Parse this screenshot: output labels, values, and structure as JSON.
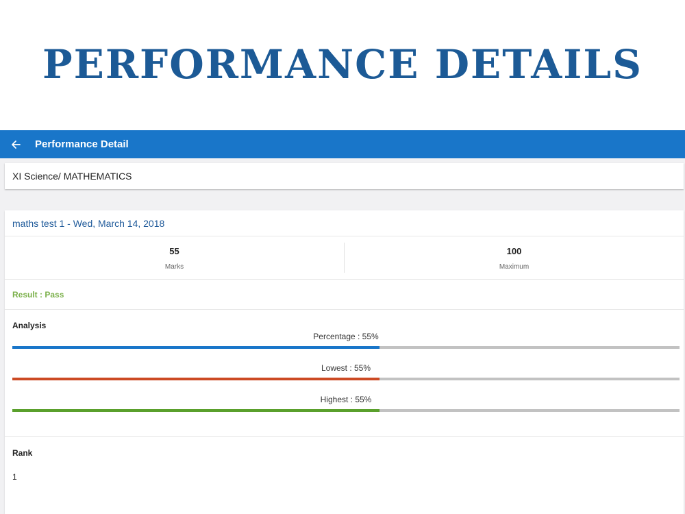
{
  "banner": {
    "title": "PERFORMANCE DETAILS"
  },
  "appbar": {
    "title": "Performance Detail",
    "back_icon": "arrow-left-icon"
  },
  "course": {
    "label": "XI Science/ MATHEMATICS"
  },
  "test": {
    "title": "maths test 1 - Wed, March 14, 2018",
    "marks": {
      "value": "55",
      "label": "Marks"
    },
    "maximum": {
      "value": "100",
      "label": "Maximum"
    },
    "result": "Result : Pass"
  },
  "analysis": {
    "heading": "Analysis",
    "metrics": [
      {
        "label": "Percentage : 55%",
        "percent": 55,
        "color": "#1976c9"
      },
      {
        "label": "Lowest : 55%",
        "percent": 55,
        "color": "#cc4a24"
      },
      {
        "label": "Highest : 55%",
        "percent": 55,
        "color": "#5aa02c"
      }
    ]
  },
  "rank": {
    "heading": "Rank",
    "value": "1"
  },
  "colors": {
    "primary": "#1976c9",
    "banner_text": "#1c5a96",
    "pass": "#7bb04a",
    "track": "#c2c2c2"
  }
}
